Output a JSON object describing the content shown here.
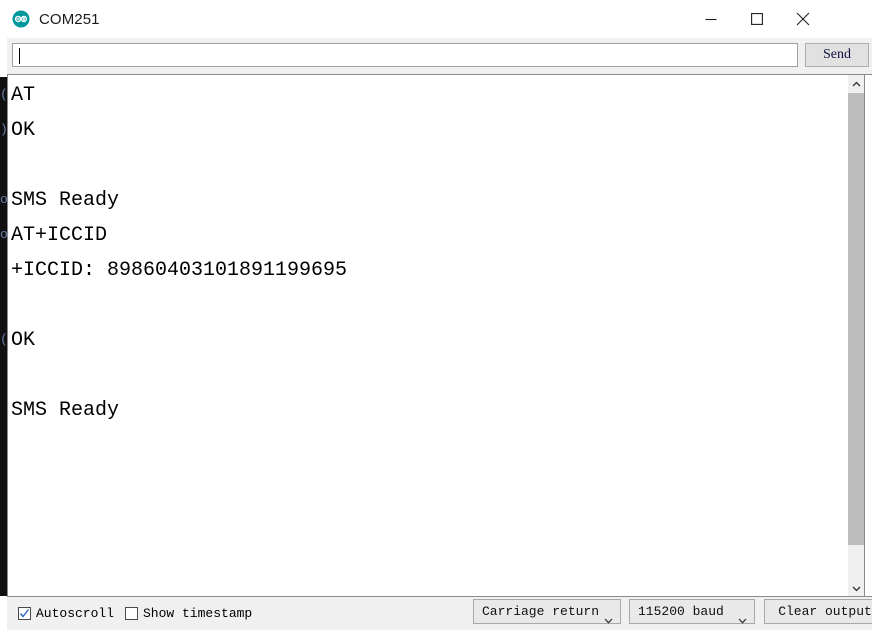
{
  "window": {
    "title": "COM251",
    "app_icon": "arduino-logo-icon",
    "accent_color": "#00979c",
    "controls": {
      "minimize": "minimize-icon",
      "maximize": "maximize-icon",
      "close": "close-icon"
    }
  },
  "send_bar": {
    "input_value": "",
    "input_placeholder": "",
    "send_label": "Send"
  },
  "console": {
    "lines": [
      "AT",
      "OK",
      "",
      "SMS Ready",
      "AT+ICCID",
      "+ICCID: 89860403101891199695",
      "",
      "OK",
      "",
      "SMS Ready"
    ],
    "iccid": "89860403101891199695"
  },
  "scrollbar": {
    "up_icon": "chevron-up-icon",
    "down_icon": "chevron-down-icon"
  },
  "status_bar": {
    "autoscroll": {
      "label": "Autoscroll",
      "checked": true
    },
    "show_timestamp": {
      "label": "Show timestamp",
      "checked": false
    },
    "line_ending": {
      "selected": "Carriage return",
      "chevron": "chevron-down-icon"
    },
    "baud_rate": {
      "selected": "115200 baud",
      "chevron": "chevron-down-icon"
    },
    "clear_output_label": "Clear output"
  },
  "background_window": {
    "fragments": [
      "(",
      ")",
      "",
      "o",
      "o",
      "",
      "",
      "(",
      "",
      ""
    ]
  }
}
